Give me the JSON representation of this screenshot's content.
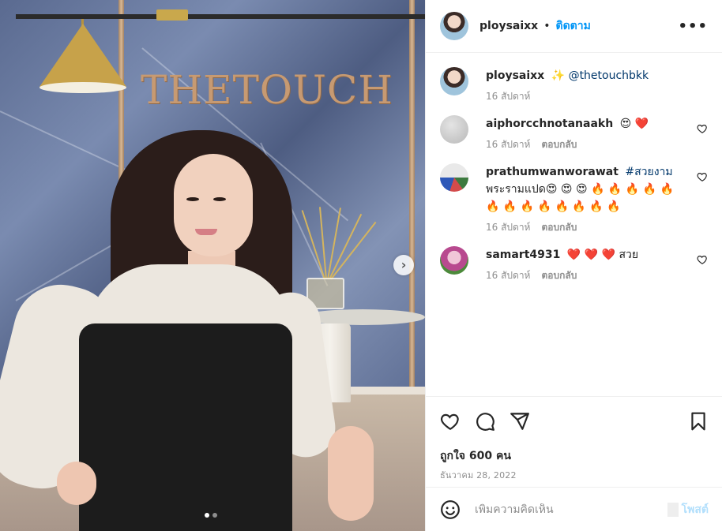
{
  "photo": {
    "brand_sign": "THETOUCH",
    "next_icon": "chevron-right-icon",
    "carousel": {
      "count": 2,
      "active": 1
    }
  },
  "header": {
    "username": "ploysaixx",
    "separator": "•",
    "follow_label": "ติดตาม",
    "more_label": "•••"
  },
  "caption": {
    "username": "ploysaixx",
    "emoji": "✨",
    "mention": "@thetouchbkk",
    "time": "16 สัปดาห์"
  },
  "comments": [
    {
      "username": "aiphorcchnotanaakh",
      "text": "😍 ❤️",
      "time": "16 สัปดาห์",
      "reply_label": "ตอบกลับ"
    },
    {
      "username": "prathumwanworawat",
      "tag": "#สวยงาม",
      "text": "พระรามแปด😍 😍 😍 🔥 🔥 🔥 🔥 🔥 🔥 🔥 🔥 🔥 🔥 🔥 🔥 🔥",
      "time": "16 สัปดาห์",
      "reply_label": "ตอบกลับ"
    },
    {
      "username": "samart4931",
      "text": "❤️ ❤️ ❤️ สวย",
      "time": "16 สัปดาห์",
      "reply_label": "ตอบกลับ"
    }
  ],
  "actions": {
    "icons": [
      "heart-icon",
      "comment-icon",
      "share-icon",
      "bookmark-icon"
    ],
    "likes": "ถูกใจ 600 คน",
    "date": "ธันวาคม 28, 2022"
  },
  "add_comment": {
    "placeholder": "เพิ่มความคิดเห็น",
    "post_label": "โพสต์",
    "emoji_icon": "smiley-icon"
  }
}
